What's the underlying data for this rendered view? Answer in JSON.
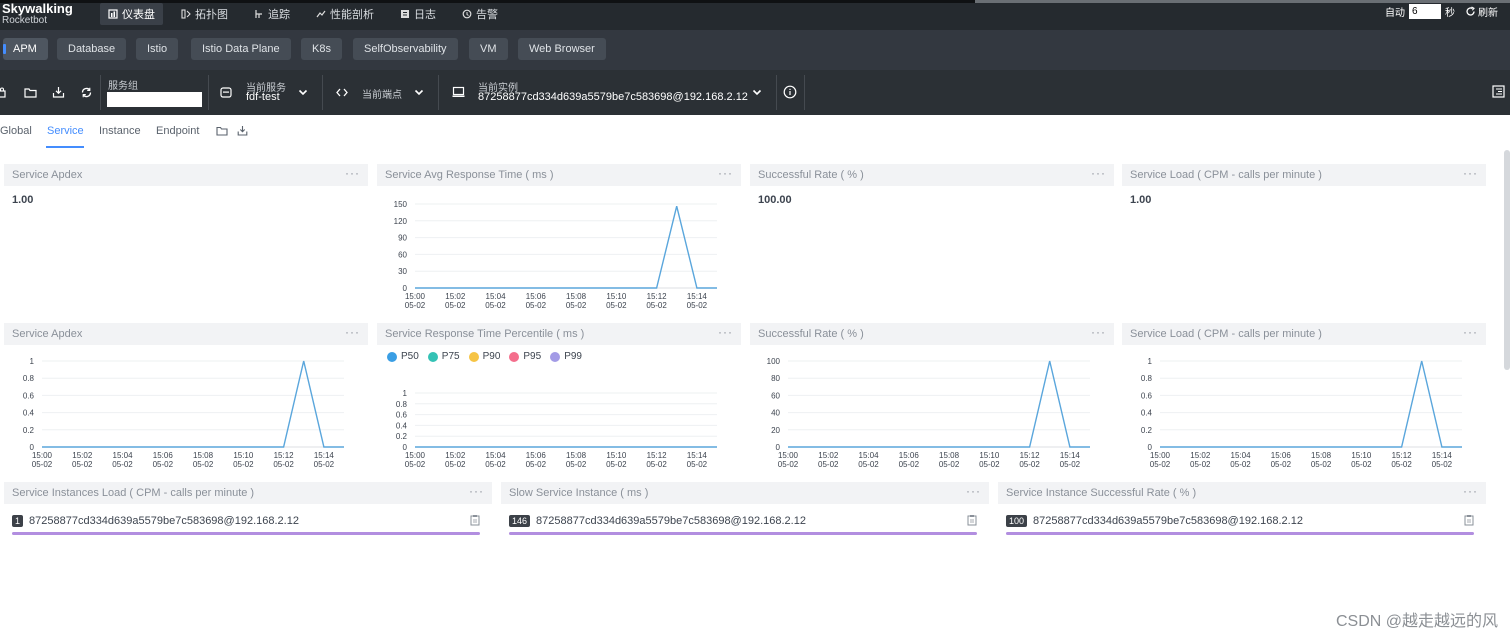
{
  "app": {
    "logo_main": "Skywalking",
    "logo_sub": "Rocketbot"
  },
  "nav": [
    {
      "label": "仪表盘",
      "icon": "dashboard-icon",
      "active": true
    },
    {
      "label": "拓扑图",
      "icon": "topology-icon",
      "active": false
    },
    {
      "label": "追踪",
      "icon": "trace-icon",
      "active": false
    },
    {
      "label": "性能剖析",
      "icon": "profile-icon",
      "active": false
    },
    {
      "label": "日志",
      "icon": "log-icon",
      "active": false
    },
    {
      "label": "告警",
      "icon": "alarm-icon",
      "active": false
    }
  ],
  "auto_refresh": {
    "label": "自动",
    "value": "6",
    "unit": "秒",
    "refresh_label": "刷新"
  },
  "layers": [
    {
      "label": "APM",
      "active": true
    },
    {
      "label": "Database",
      "active": false
    },
    {
      "label": "Istio",
      "active": false
    },
    {
      "label": "Istio Data Plane",
      "active": false
    },
    {
      "label": "K8s",
      "active": false
    },
    {
      "label": "SelfObservability",
      "active": false
    },
    {
      "label": "VM",
      "active": false
    },
    {
      "label": "Web Browser",
      "active": false
    }
  ],
  "toolbar": {
    "service_group_label": "服务组",
    "service_group_value": "",
    "current_service_label": "当前服务",
    "current_service_value": "fdf-test",
    "current_endpoint_label": "当前端点",
    "current_instance_label": "当前实例",
    "current_instance_value": "87258877cd334d639a5579be7c583698@192.168.2.12"
  },
  "tabs": [
    {
      "label": "Global",
      "active": false
    },
    {
      "label": "Service",
      "active": true
    },
    {
      "label": "Instance",
      "active": false
    },
    {
      "label": "Endpoint",
      "active": false
    }
  ],
  "colors": {
    "accent": "#448dfe",
    "line": "#5aa6dc",
    "bar": "#b28ee0",
    "p50": "#3a9ee4",
    "p75": "#34c2b5",
    "p90": "#f6c445",
    "p95": "#f46e8c",
    "p99": "#a39be6"
  },
  "time_labels": {
    "full": [
      [
        "15:00",
        "05-02"
      ],
      [
        "15:02",
        "05-02"
      ],
      [
        "15:04",
        "05-02"
      ],
      [
        "15:06",
        "05-02"
      ],
      [
        "15:08",
        "05-02"
      ],
      [
        "15:10",
        "05-02"
      ],
      [
        "15:12",
        "05-02"
      ],
      [
        "15:14",
        "05-02"
      ]
    ],
    "row1": [
      [
        "15:00",
        "05-02"
      ],
      [
        "15:02",
        "05-02"
      ],
      [
        "15:04",
        "05-02"
      ],
      [
        "15:06",
        "05-02"
      ],
      [
        "15:08",
        "05-02"
      ],
      [
        "15:10",
        "05-02"
      ],
      [
        "15:12",
        "05-02"
      ],
      [
        "15:14",
        "05-02"
      ]
    ]
  },
  "cards": {
    "apdex_value": {
      "title": "Service Apdex",
      "value": "1.00"
    },
    "avg_response": {
      "title": "Service Avg Response Time ( ms )"
    },
    "success_value": {
      "title": "Successful Rate ( % )",
      "value": "100.00"
    },
    "load_value": {
      "title": "Service Load ( CPM - calls per minute )",
      "value": "1.00"
    },
    "apdex_chart": {
      "title": "Service Apdex"
    },
    "percentile_chart": {
      "title": "Service Response Time Percentile ( ms )",
      "legend": [
        "P50",
        "P75",
        "P90",
        "P95",
        "P99"
      ]
    },
    "success_chart": {
      "title": "Successful Rate ( % )"
    },
    "load_chart": {
      "title": "Service Load ( CPM - calls per minute )"
    },
    "inst_load": {
      "title": "Service Instances Load ( CPM - calls per minute )",
      "badge": "1",
      "instance": "87258877cd334d639a5579be7c583698@192.168.2.12"
    },
    "slow_inst": {
      "title": "Slow Service Instance ( ms )",
      "badge": "146",
      "instance": "87258877cd334d639a5579be7c583698@192.168.2.12"
    },
    "inst_success": {
      "title": "Service Instance Successful Rate ( % )",
      "badge": "100",
      "instance": "87258877cd334d639a5579be7c583698@192.168.2.12"
    }
  },
  "chart_data": [
    {
      "type": "line",
      "id": "avg_response",
      "x": [
        "15:00",
        "15:01",
        "15:02",
        "15:03",
        "15:04",
        "15:05",
        "15:06",
        "15:07",
        "15:08",
        "15:09",
        "15:10",
        "15:11",
        "15:12",
        "15:13",
        "15:14",
        "15:15"
      ],
      "series": [
        {
          "values": [
            0,
            0,
            0,
            0,
            0,
            0,
            0,
            0,
            0,
            0,
            0,
            0,
            0,
            146,
            0,
            0
          ]
        }
      ],
      "ylim": [
        0,
        150
      ],
      "yticks": [
        "0",
        "30",
        "60",
        "90",
        "120",
        "150"
      ]
    },
    {
      "type": "line",
      "id": "apdex_chart",
      "x": [
        "15:00",
        "15:01",
        "15:02",
        "15:03",
        "15:04",
        "15:05",
        "15:06",
        "15:07",
        "15:08",
        "15:09",
        "15:10",
        "15:11",
        "15:12",
        "15:13",
        "15:14",
        "15:15"
      ],
      "series": [
        {
          "values": [
            0,
            0,
            0,
            0,
            0,
            0,
            0,
            0,
            0,
            0,
            0,
            0,
            0,
            1,
            0,
            0
          ]
        }
      ],
      "ylim": [
        0,
        1
      ],
      "yticks": [
        "0",
        "0.2",
        "0.4",
        "0.6",
        "0.8",
        "1"
      ]
    },
    {
      "type": "line",
      "id": "percentile_chart",
      "x": [
        "15:00",
        "15:01",
        "15:02",
        "15:03",
        "15:04",
        "15:05",
        "15:06",
        "15:07",
        "15:08",
        "15:09",
        "15:10",
        "15:11",
        "15:12",
        "15:13",
        "15:14",
        "15:15"
      ],
      "series": [
        {
          "name": "P50",
          "values": [
            0,
            0,
            0,
            0,
            0,
            0,
            0,
            0,
            0,
            0,
            0,
            0,
            0,
            0,
            0,
            0
          ]
        }
      ],
      "ylim": [
        0,
        1
      ],
      "yticks": [
        "0",
        "0.2",
        "0.4",
        "0.6",
        "0.8",
        "1"
      ]
    },
    {
      "type": "line",
      "id": "success_chart",
      "x": [
        "15:00",
        "15:01",
        "15:02",
        "15:03",
        "15:04",
        "15:05",
        "15:06",
        "15:07",
        "15:08",
        "15:09",
        "15:10",
        "15:11",
        "15:12",
        "15:13",
        "15:14",
        "15:15"
      ],
      "series": [
        {
          "values": [
            0,
            0,
            0,
            0,
            0,
            0,
            0,
            0,
            0,
            0,
            0,
            0,
            0,
            100,
            0,
            0
          ]
        }
      ],
      "ylim": [
        0,
        100
      ],
      "yticks": [
        "0",
        "20",
        "40",
        "60",
        "80",
        "100"
      ]
    },
    {
      "type": "line",
      "id": "load_chart",
      "x": [
        "15:00",
        "15:01",
        "15:02",
        "15:03",
        "15:04",
        "15:05",
        "15:06",
        "15:07",
        "15:08",
        "15:09",
        "15:10",
        "15:11",
        "15:12",
        "15:13",
        "15:14",
        "15:15"
      ],
      "series": [
        {
          "values": [
            0,
            0,
            0,
            0,
            0,
            0,
            0,
            0,
            0,
            0,
            0,
            0,
            0,
            1,
            0,
            0
          ]
        }
      ],
      "ylim": [
        0,
        1
      ],
      "yticks": [
        "0",
        "0.2",
        "0.4",
        "0.6",
        "0.8",
        "1"
      ]
    }
  ],
  "watermark": "CSDN @越走越远的风"
}
